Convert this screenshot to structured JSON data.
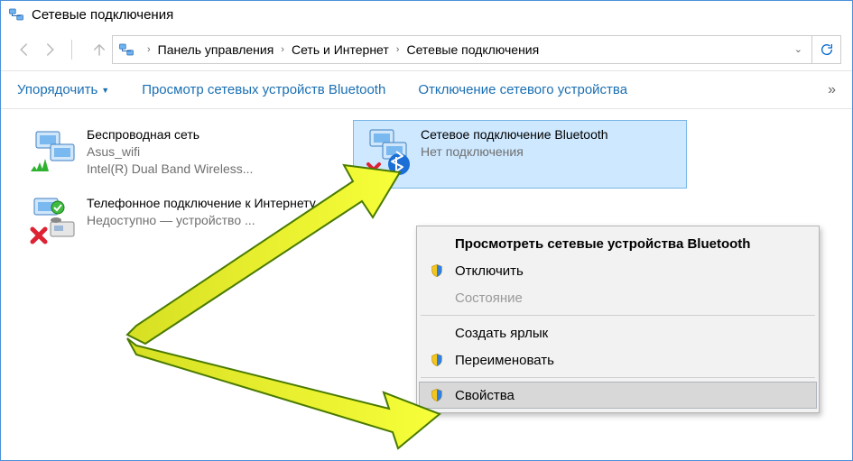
{
  "window": {
    "title": "Сетевые подключения"
  },
  "breadcrumb": {
    "segments": [
      "Панель управления",
      "Сеть и Интернет",
      "Сетевые подключения"
    ]
  },
  "toolbar": {
    "organize": "Упорядочить",
    "view_bt": "Просмотр сетевых устройств Bluetooth",
    "disable": "Отключение сетевого устройства",
    "overflow": "»"
  },
  "connections": [
    {
      "name": "Беспроводная сеть",
      "sub1": "Asus_wifi",
      "sub2": "Intel(R) Dual Band Wireless...",
      "icon": "wifi",
      "selected": false
    },
    {
      "name": "Сетевое подключение Bluetooth",
      "sub1": "Нет подключения",
      "sub2": "",
      "icon": "bt",
      "selected": true
    },
    {
      "name": "Телефонное подключение к Интернету",
      "sub1": "Недоступно — устройство ...",
      "sub2": "",
      "icon": "dialup",
      "selected": false
    }
  ],
  "context_menu": {
    "view_devices": "Просмотреть сетевые устройства Bluetooth",
    "disable": "Отключить",
    "status": "Состояние",
    "create_shortcut": "Создать ярлык",
    "rename": "Переименовать",
    "properties": "Свойства"
  }
}
